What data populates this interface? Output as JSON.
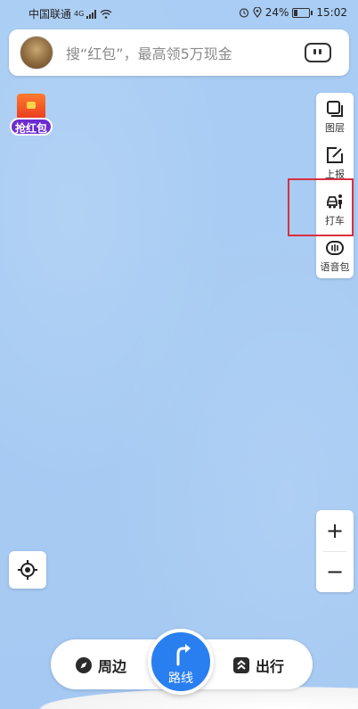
{
  "status": {
    "carrier": "中国联通",
    "network": "4G",
    "battery": "24%",
    "time": "15:02"
  },
  "search": {
    "placeholder": "搜“红包”，最高领5万现金"
  },
  "promo": {
    "label": "抢红包"
  },
  "toolbar": {
    "items": [
      {
        "label": "图层"
      },
      {
        "label": "上报"
      },
      {
        "label": "打车"
      },
      {
        "label": "语音包"
      }
    ]
  },
  "zoom": {
    "in": "+",
    "out": "−"
  },
  "bottom": {
    "nearby": "周边",
    "route": "路线",
    "travel": "出行"
  },
  "colors": {
    "map": "#a7cbf3",
    "accent": "#2a7ff0",
    "highlight": "#d9313f"
  }
}
